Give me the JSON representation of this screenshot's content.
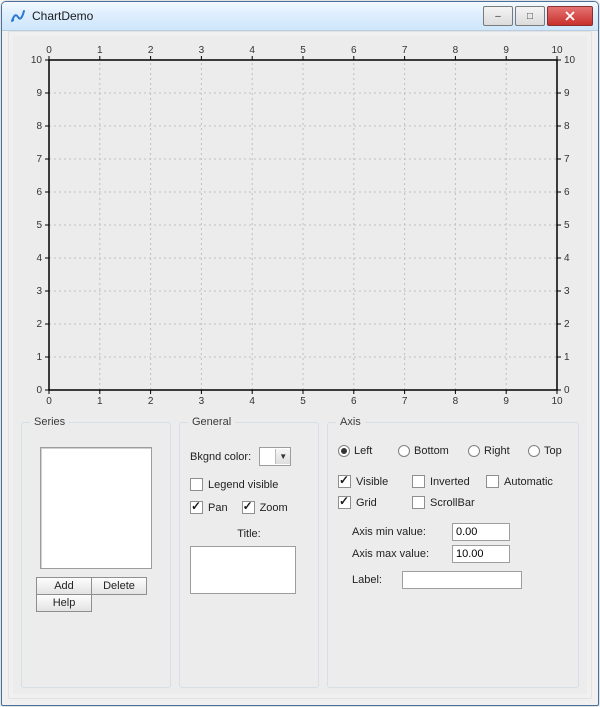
{
  "window": {
    "title": "ChartDemo"
  },
  "chart_data": {
    "type": "scatter",
    "series": [],
    "xlim": [
      0,
      10
    ],
    "ylim": [
      0,
      10
    ],
    "xticks": [
      0,
      1,
      2,
      3,
      4,
      5,
      6,
      7,
      8,
      9,
      10
    ],
    "yticks": [
      0,
      1,
      2,
      3,
      4,
      5,
      6,
      7,
      8,
      9,
      10
    ],
    "grid": true,
    "title": "",
    "xlabel": "",
    "ylabel": ""
  },
  "series": {
    "legend": "Series",
    "buttons": {
      "add": "Add",
      "delete": "Delete",
      "help": "Help"
    }
  },
  "general": {
    "legend": "General",
    "bkgnd_label": "Bkgnd color:",
    "legend_visible_label": "Legend visible",
    "legend_visible": false,
    "pan_label": "Pan",
    "pan": true,
    "zoom_label": "Zoom",
    "zoom": true,
    "title_label": "Title:",
    "title_value": ""
  },
  "axis": {
    "legend": "Axis",
    "radios": {
      "left": "Left",
      "bottom": "Bottom",
      "right": "Right",
      "top": "Top",
      "selected": "left"
    },
    "checks": {
      "visible": {
        "label": "Visible",
        "value": true
      },
      "inverted": {
        "label": "Inverted",
        "value": false
      },
      "automatic": {
        "label": "Automatic",
        "value": false
      },
      "grid_": {
        "label": "Grid",
        "value": true
      },
      "scrollbar": {
        "label": "ScrollBar",
        "value": false
      }
    },
    "min_label": "Axis min value:",
    "min_value": "0.00",
    "max_label": "Axis max value:",
    "max_value": "10.00",
    "label_label": "Label:",
    "label_value": ""
  }
}
